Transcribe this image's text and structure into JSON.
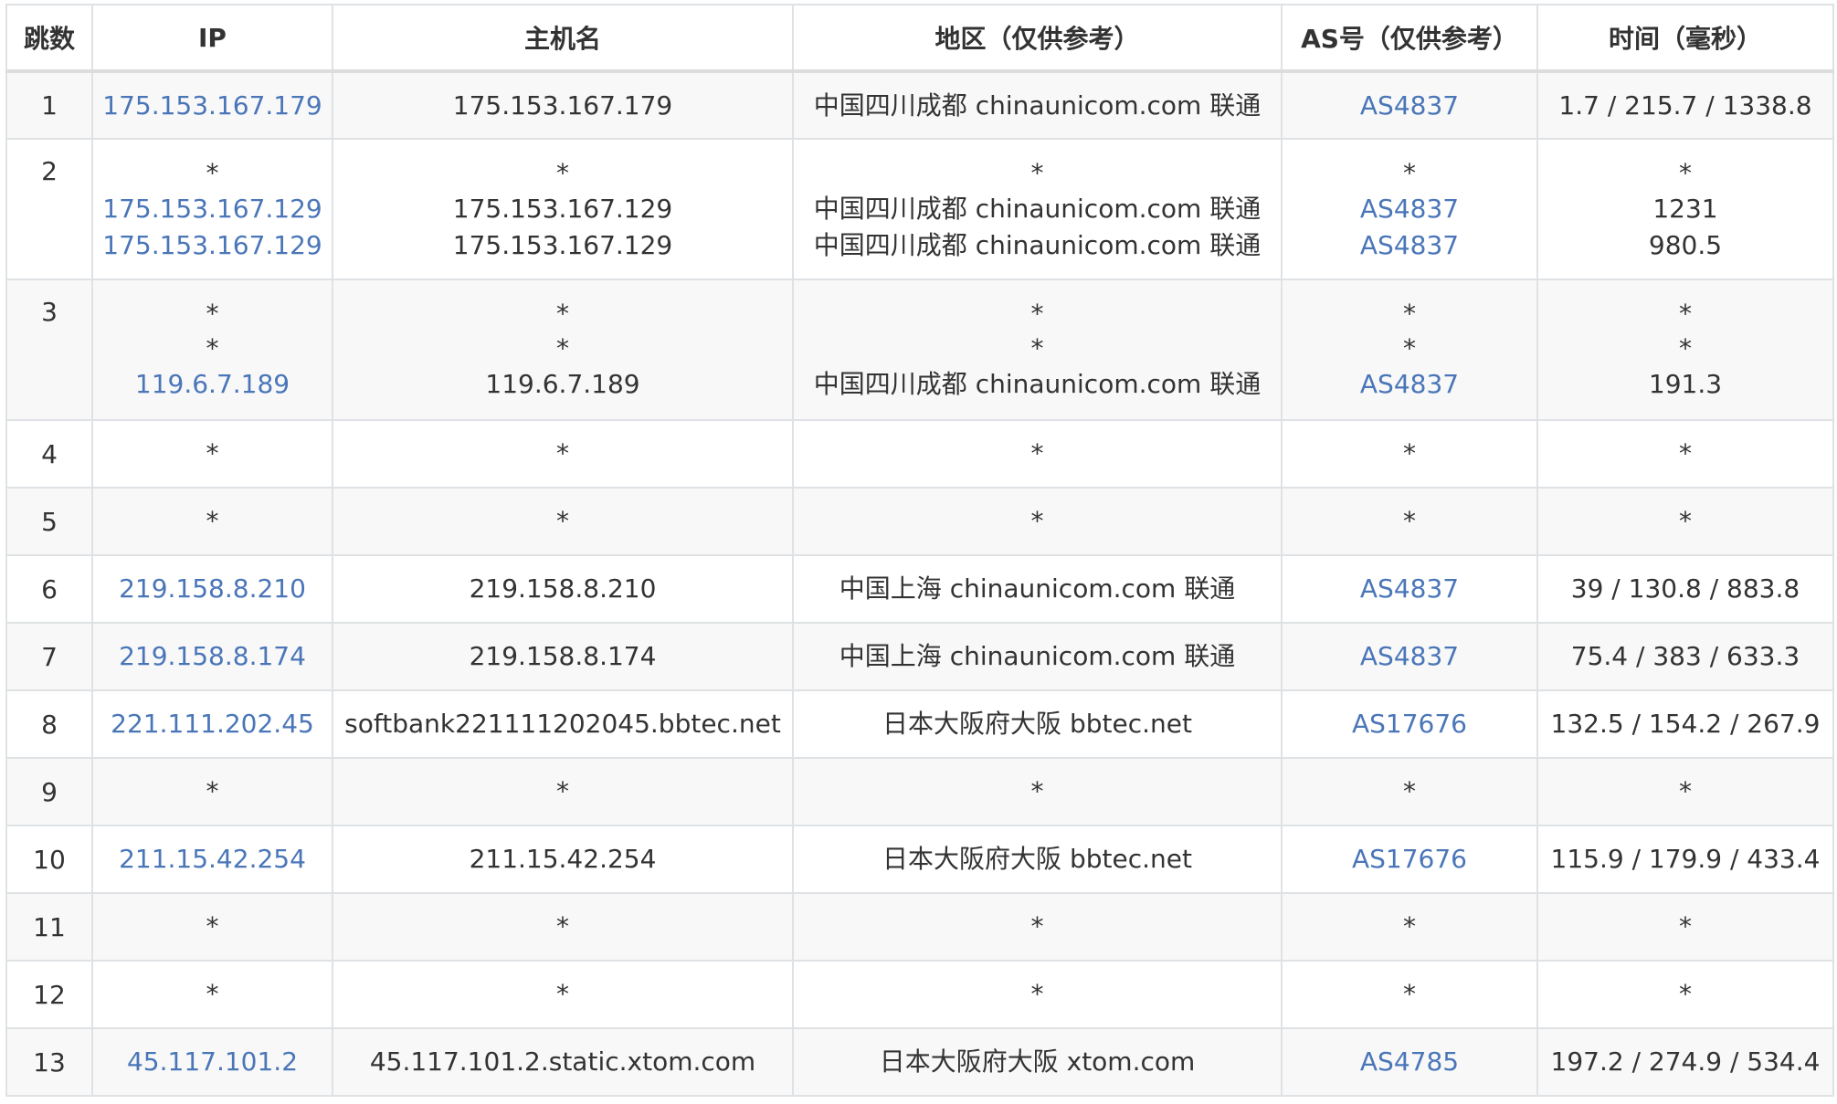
{
  "headers": [
    "跳数",
    "IP",
    "主机名",
    "地区（仅供参考）",
    "AS号（仅供参考）",
    "时间（毫秒）"
  ],
  "rows": [
    {
      "hop": "1",
      "ip": [
        "175.153.167.179"
      ],
      "host": [
        "175.153.167.179"
      ],
      "region": [
        "中国四川成都 chinaunicom.com 联通"
      ],
      "as": [
        "AS4837"
      ],
      "time": [
        "1.7 / 215.7 / 1338.8"
      ]
    },
    {
      "hop": "2",
      "ip": [
        "*",
        "175.153.167.129",
        "175.153.167.129"
      ],
      "host": [
        "*",
        "175.153.167.129",
        "175.153.167.129"
      ],
      "region": [
        "*",
        "中国四川成都 chinaunicom.com 联通",
        "中国四川成都 chinaunicom.com 联通"
      ],
      "as": [
        "*",
        "AS4837",
        "AS4837"
      ],
      "time": [
        "*",
        "1231",
        "980.5"
      ]
    },
    {
      "hop": "3",
      "ip": [
        "*",
        "*",
        "119.6.7.189"
      ],
      "host": [
        "*",
        "*",
        "119.6.7.189"
      ],
      "region": [
        "*",
        "*",
        "中国四川成都 chinaunicom.com 联通"
      ],
      "as": [
        "*",
        "*",
        "AS4837"
      ],
      "time": [
        "*",
        "*",
        "191.3"
      ]
    },
    {
      "hop": "4",
      "ip": [
        "*"
      ],
      "host": [
        "*"
      ],
      "region": [
        "*"
      ],
      "as": [
        "*"
      ],
      "time": [
        "*"
      ]
    },
    {
      "hop": "5",
      "ip": [
        "*"
      ],
      "host": [
        "*"
      ],
      "region": [
        "*"
      ],
      "as": [
        "*"
      ],
      "time": [
        "*"
      ]
    },
    {
      "hop": "6",
      "ip": [
        "219.158.8.210"
      ],
      "host": [
        "219.158.8.210"
      ],
      "region": [
        "中国上海 chinaunicom.com 联通"
      ],
      "as": [
        "AS4837"
      ],
      "time": [
        "39 / 130.8 / 883.8"
      ]
    },
    {
      "hop": "7",
      "ip": [
        "219.158.8.174"
      ],
      "host": [
        "219.158.8.174"
      ],
      "region": [
        "中国上海 chinaunicom.com 联通"
      ],
      "as": [
        "AS4837"
      ],
      "time": [
        "75.4 / 383 / 633.3"
      ]
    },
    {
      "hop": "8",
      "ip": [
        "221.111.202.45"
      ],
      "host": [
        "softbank221111202045.bbtec.net"
      ],
      "region": [
        "日本大阪府大阪 bbtec.net"
      ],
      "as": [
        "AS17676"
      ],
      "time": [
        "132.5 / 154.2 / 267.9"
      ]
    },
    {
      "hop": "9",
      "ip": [
        "*"
      ],
      "host": [
        "*"
      ],
      "region": [
        "*"
      ],
      "as": [
        "*"
      ],
      "time": [
        "*"
      ]
    },
    {
      "hop": "10",
      "ip": [
        "211.15.42.254"
      ],
      "host": [
        "211.15.42.254"
      ],
      "region": [
        "日本大阪府大阪 bbtec.net"
      ],
      "as": [
        "AS17676"
      ],
      "time": [
        "115.9 / 179.9 / 433.4"
      ]
    },
    {
      "hop": "11",
      "ip": [
        "*"
      ],
      "host": [
        "*"
      ],
      "region": [
        "*"
      ],
      "as": [
        "*"
      ],
      "time": [
        "*"
      ]
    },
    {
      "hop": "12",
      "ip": [
        "*"
      ],
      "host": [
        "*"
      ],
      "region": [
        "*"
      ],
      "as": [
        "*"
      ],
      "time": [
        "*"
      ]
    },
    {
      "hop": "13",
      "ip": [
        "45.117.101.2"
      ],
      "host": [
        "45.117.101.2.static.xtom.com"
      ],
      "region": [
        "日本大阪府大阪 xtom.com"
      ],
      "as": [
        "AS4785"
      ],
      "time": [
        "197.2 / 274.9 / 534.4"
      ]
    }
  ]
}
